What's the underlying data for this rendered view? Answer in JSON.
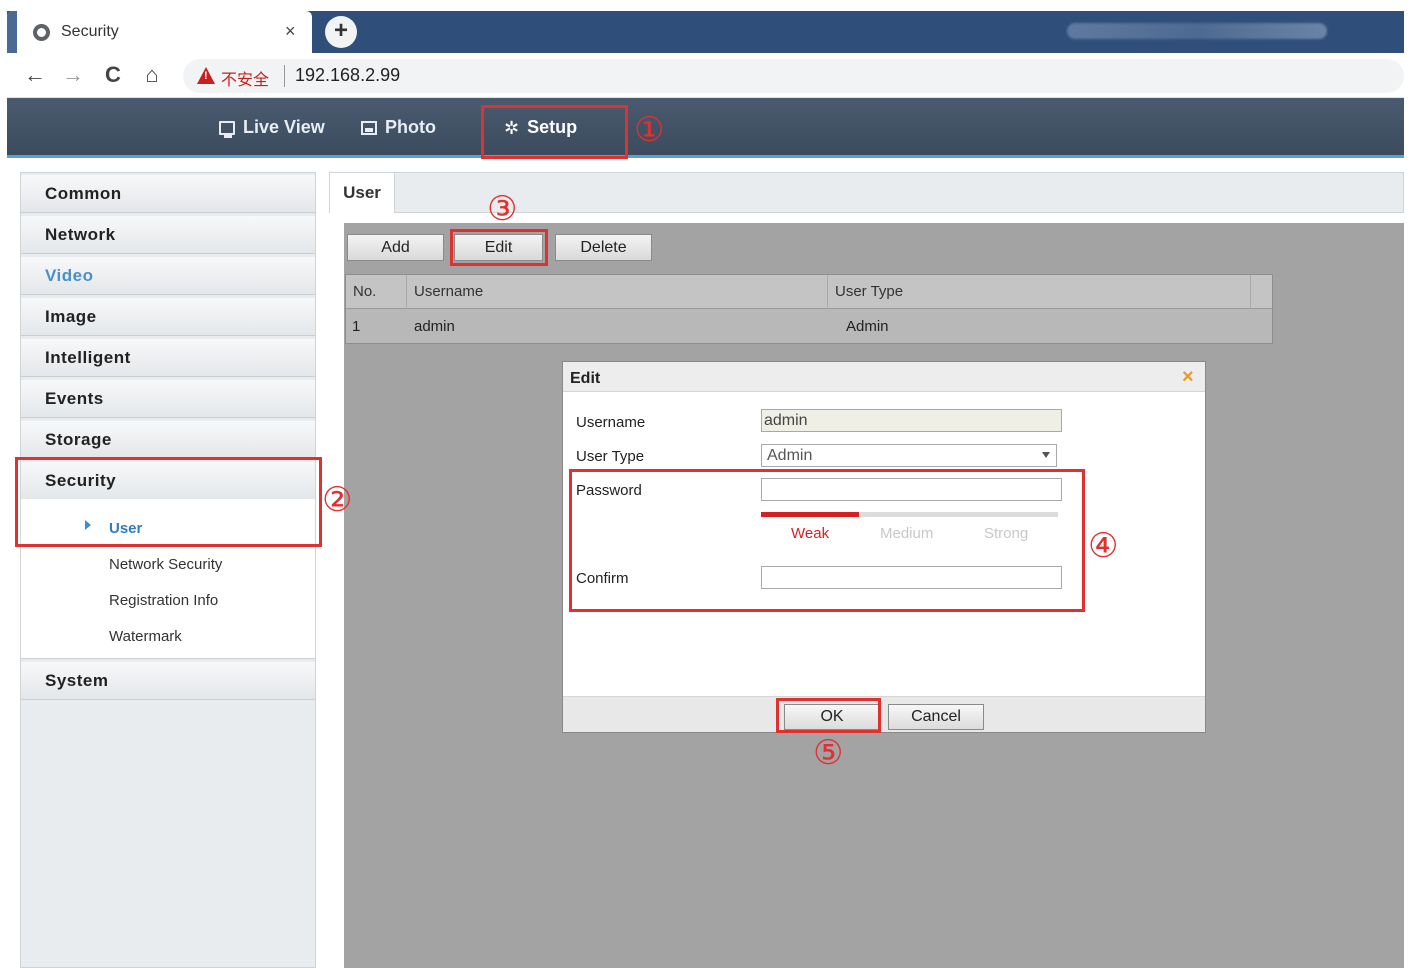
{
  "browser": {
    "tab_title": "Security",
    "tab_close": "×",
    "new_tab": "+",
    "nav_back": "←",
    "nav_forward": "→",
    "nav_reload": "C",
    "nav_home": "⌂",
    "insecure_label": "不安全",
    "url": "192.168.2.99"
  },
  "header": {
    "live_view": "Live View",
    "photo": "Photo",
    "setup": "Setup",
    "setup_icon": "✲"
  },
  "sidebar": {
    "categories": [
      "Common",
      "Network",
      "Video",
      "Image",
      "Intelligent",
      "Events",
      "Storage",
      "Security",
      "System"
    ],
    "security_items": [
      "User",
      "Network Security",
      "Registration Info",
      "Watermark"
    ]
  },
  "main": {
    "tab": "User",
    "toolbar": {
      "add": "Add",
      "edit": "Edit",
      "delete": "Delete"
    },
    "table": {
      "columns": [
        "No.",
        "Username",
        "User Type"
      ],
      "rows": [
        {
          "no": "1",
          "username": "admin",
          "user_type": "Admin"
        }
      ]
    }
  },
  "dialog": {
    "title": "Edit",
    "close": "×",
    "username_label": "Username",
    "username_value": "admin",
    "user_type_label": "User Type",
    "user_type_value": "Admin",
    "password_label": "Password",
    "password_value": "",
    "confirm_label": "Confirm",
    "confirm_value": "",
    "strength": {
      "weak": "Weak",
      "medium": "Medium",
      "strong": "Strong",
      "level": 0.33
    },
    "ok": "OK",
    "cancel": "Cancel"
  },
  "annotations": [
    "①",
    "②",
    "③",
    "④",
    "⑤"
  ],
  "colors": {
    "annotation": "#e03030",
    "header": "#3c4b5e",
    "accent": "#2f7ec0",
    "weak": "#d42222"
  }
}
